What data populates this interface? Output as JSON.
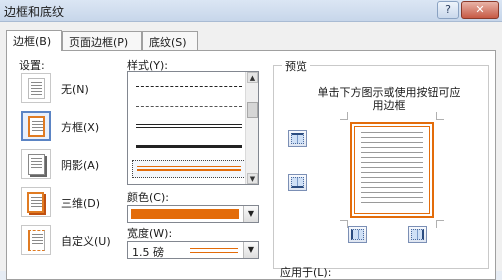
{
  "dialog": {
    "title": "边框和底纹",
    "help_glyph": "?",
    "close_glyph": "✕"
  },
  "tabs": [
    {
      "label": "边框(B)"
    },
    {
      "label": "页面边框(P)"
    },
    {
      "label": "底纹(S)"
    }
  ],
  "settings": {
    "label": "设置:",
    "options": [
      {
        "label": "无(N)",
        "icon": "no-border-icon"
      },
      {
        "label": "方框(X)",
        "icon": "box-border-icon",
        "selected": true
      },
      {
        "label": "阴影(A)",
        "icon": "shadow-border-icon"
      },
      {
        "label": "三维(D)",
        "icon": "3d-border-icon"
      },
      {
        "label": "自定义(U)",
        "icon": "custom-border-icon"
      }
    ]
  },
  "style": {
    "label": "样式(Y):",
    "items": [
      "dash-dot",
      "dashed",
      "double",
      "thick",
      "thin-thick-orange"
    ],
    "selected_index": 4
  },
  "color": {
    "label": "颜色(C):",
    "value": "#E36C0A"
  },
  "width": {
    "label": "宽度(W):",
    "value": "1.5 磅"
  },
  "preview": {
    "label": "预览",
    "hint": "单击下方图示或使用按钮可应用边框"
  },
  "apply_to": {
    "label": "应用于(L):"
  }
}
